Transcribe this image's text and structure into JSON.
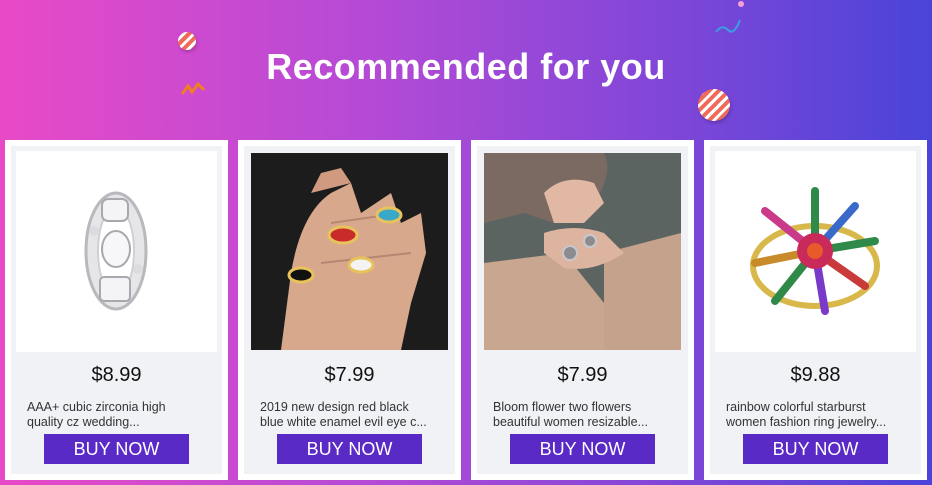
{
  "header": {
    "title": "Recommended for you"
  },
  "products": [
    {
      "price": "$8.99",
      "desc_line1": "AAA+ cubic zirconia high",
      "desc_line2": "quality cz wedding...",
      "button": "BUY NOW",
      "image": "silver-cz-eternity-ring-image"
    },
    {
      "price": "$7.99",
      "desc_line1": "2019 new design red black",
      "desc_line2": "blue white enamel evil eye c...",
      "button": "BUY NOW",
      "image": "evil-eye-rings-on-hand-image"
    },
    {
      "price": "$7.99",
      "desc_line1": "Bloom flower two flowers",
      "desc_line2": "beautiful women resizable...",
      "button": "BUY NOW",
      "image": "flower-ring-on-hand-image"
    },
    {
      "price": "$9.88",
      "desc_line1": "rainbow colorful starburst",
      "desc_line2": "women fashion ring jewelry...",
      "button": "BUY NOW",
      "image": "starburst-ring-image"
    }
  ],
  "colors": {
    "button": "#5a2ac7",
    "gradient_start": "#e84ac7",
    "gradient_end": "#4a44d8"
  }
}
